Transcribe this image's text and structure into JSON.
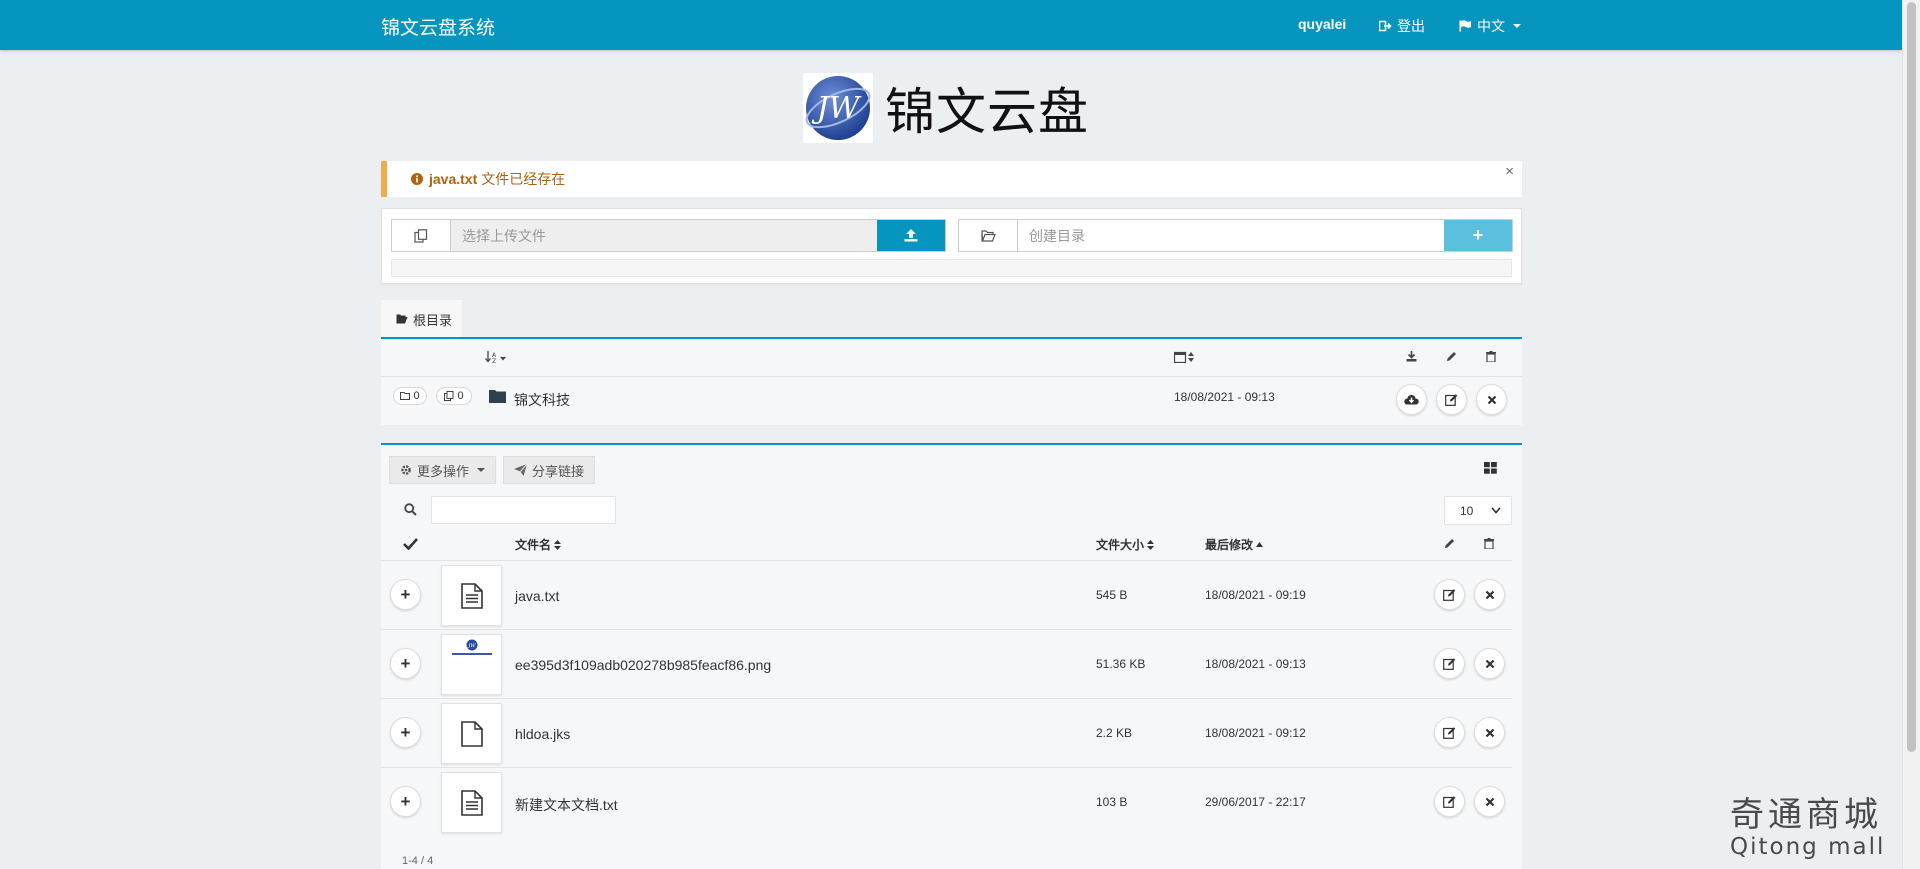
{
  "navbar": {
    "brand": "锦文云盘系统",
    "user": "quyalei",
    "logout": "登出",
    "language": "中文"
  },
  "logo": {
    "monogram": "JW",
    "title": "锦文云盘"
  },
  "alert": {
    "filename": "java.txt",
    "message": "文件已经存在",
    "close": "×"
  },
  "upload": {
    "file_placeholder": "选择上传文件",
    "dir_placeholder": "创建目录",
    "create_label": "+"
  },
  "breadcrumb": {
    "root": "根目录"
  },
  "folders": [
    {
      "dir_count": "0",
      "file_count": "0",
      "name": "锦文科技",
      "date": "18/08/2021 - 09:13"
    }
  ],
  "toolbar": {
    "more_actions": "更多操作",
    "share_link": "分享链接",
    "page_size": "10"
  },
  "table": {
    "headers": {
      "name": "文件名",
      "size": "文件大小",
      "modified": "最后修改"
    },
    "rows": [
      {
        "name": "java.txt",
        "size": "545 B",
        "date": "18/08/2021 - 09:19",
        "thumb": "text-file-icon",
        "add": "+"
      },
      {
        "name": "ee395d3f109adb020278b985feacf86.png",
        "size": "51.36 KB",
        "date": "18/08/2021 - 09:13",
        "thumb": "image-thumbnail",
        "add": "+"
      },
      {
        "name": "hldoa.jks",
        "size": "2.2 KB",
        "date": "18/08/2021 - 09:12",
        "thumb": "blank-file-icon",
        "add": "+"
      },
      {
        "name": "新建文本文档.txt",
        "size": "103 B",
        "date": "29/06/2017 - 22:17",
        "thumb": "text-file-icon",
        "add": "+"
      }
    ],
    "pagination": "1-4 / 4"
  },
  "watermark": {
    "line1": "奇通商城",
    "line2": "Qitong mall"
  },
  "colors": {
    "primary": "#0595be",
    "info": "#5bc0de",
    "warning": "#f0ad4e",
    "background": "#eceff2"
  }
}
